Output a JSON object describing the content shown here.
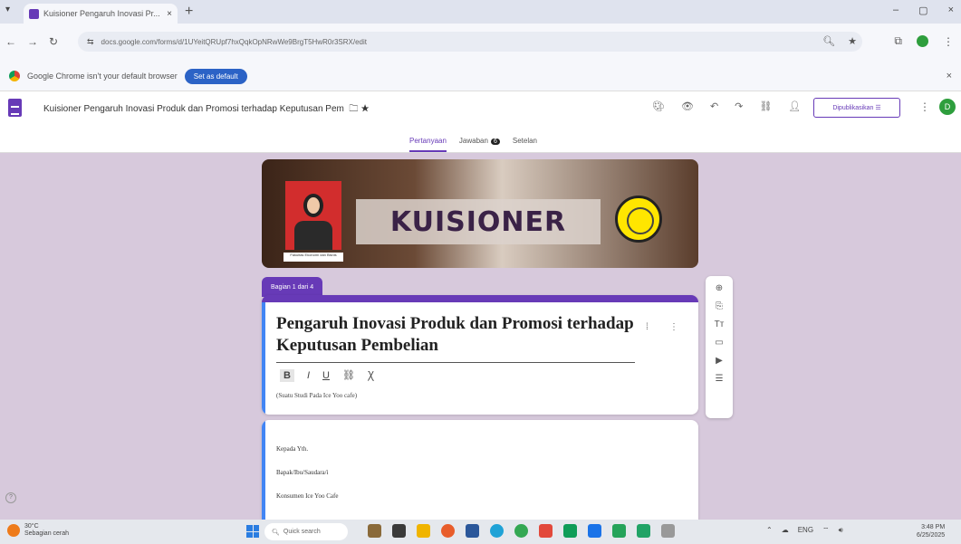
{
  "browser": {
    "tab_title": "Kuisioner Pengaruh Inovasi Pr...",
    "tab_close": "×",
    "new_tab": "+",
    "url": "docs.google.com/forms/d/1UYeitQRUpf7hxQqkOpNRwWe9BrgT5HwR0r3SRX/edit",
    "window_controls": [
      "–",
      "▢",
      "×"
    ]
  },
  "infobar": {
    "message": "Google Chrome isn't your default browser",
    "button": "Set as default",
    "close": "×"
  },
  "forms_header": {
    "title": "Kuisioner Pengaruh Inovasi Produk dan Promosi terhadap Keputusan Pem",
    "star": "★",
    "publish_label": "Dipublikasikan",
    "menu": "⋮",
    "avatar_letter": "D",
    "tabs": [
      {
        "label": "Pertanyaan"
      },
      {
        "label": "Jawaban"
      },
      {
        "label": "Setelan"
      }
    ],
    "response_count": "6"
  },
  "banner": {
    "heading": "KUISIONER",
    "photo_caption": "Fakultas Ekonomi dan Bisnis"
  },
  "section": {
    "tag": "Bagian 1 dari 4"
  },
  "card1": {
    "title": "Pengaruh Inovasi  Produk dan Promosi terhadap Keputusan Pembelian",
    "description": "(Suatu Studi Pada Ice Yoo cafe)",
    "format_buttons": [
      "B",
      "I",
      "U",
      "⛓",
      "Ꭓ"
    ]
  },
  "card2": {
    "lines": [
      "Kepada Yth.",
      "Bapak/Ibu/Saudara/i",
      "Konsumen Ice Yoo Cafe"
    ]
  },
  "taskbar": {
    "weather_temp": "30°C",
    "weather_desc": "Sebagian cerah",
    "search_placeholder": "Quick search",
    "lang": "ENG",
    "time": "3:48 PM",
    "date": "6/25/2025"
  },
  "colors": {
    "forms_purple": "#673ab7",
    "accent_blue": "#4285f4",
    "page_bg": "#d7c9dc"
  }
}
